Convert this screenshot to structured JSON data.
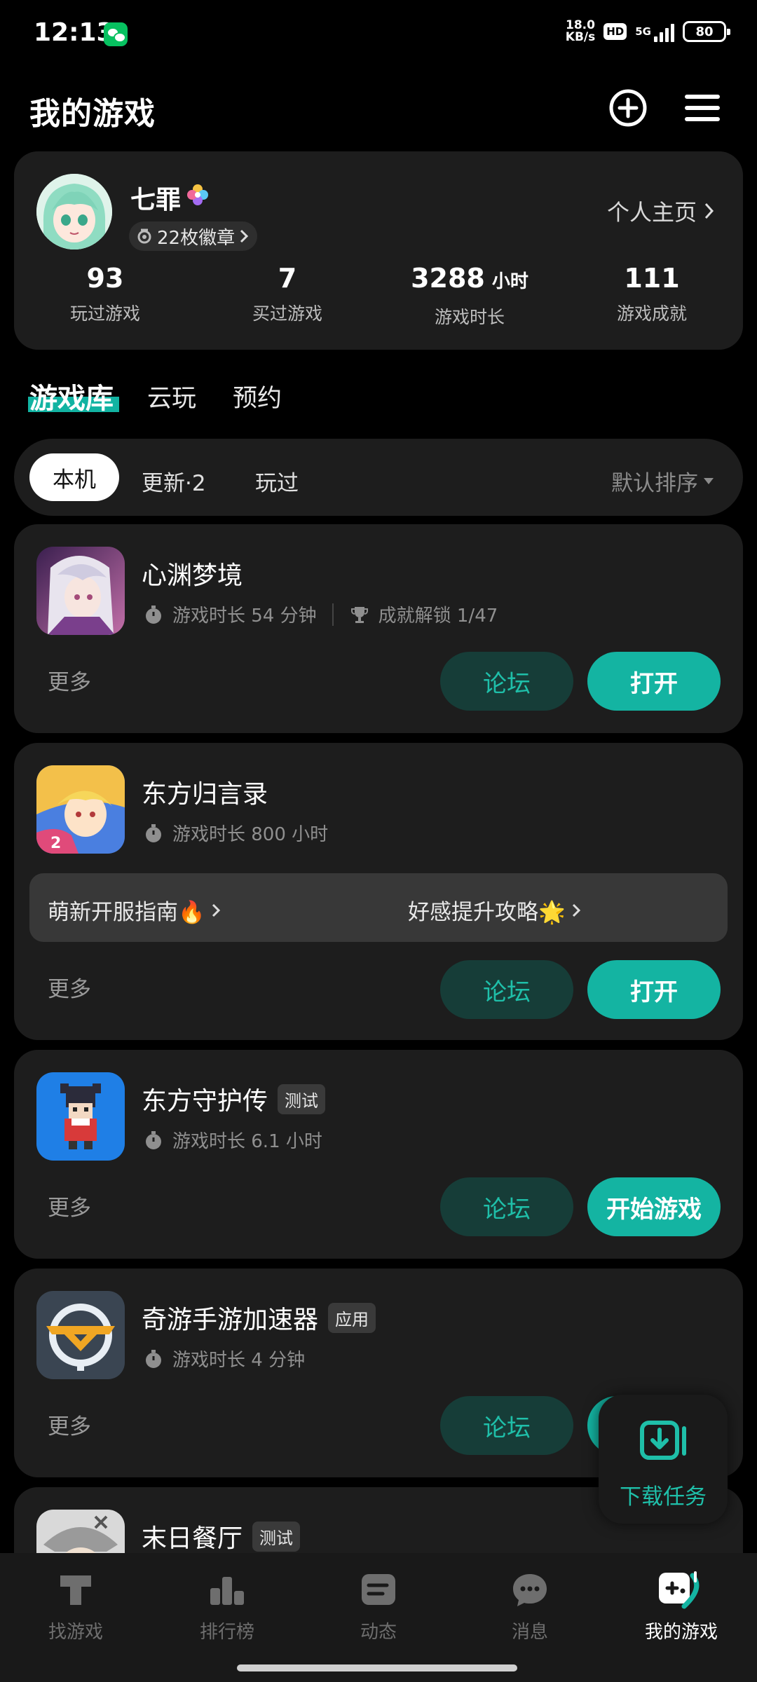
{
  "status": {
    "time": "12:13",
    "speed_top": "18.0",
    "speed_bottom": "KB/s",
    "hd": "HD",
    "network": "5G",
    "battery": "80"
  },
  "header": {
    "title": "我的游戏",
    "add_icon": "plus-circle-icon",
    "menu_icon": "menu-icon"
  },
  "profile": {
    "name": "七罪",
    "badges": "22枚徽章",
    "profile_link": "个人主页",
    "stats": [
      {
        "num": "93",
        "unit": "",
        "label": "玩过游戏"
      },
      {
        "num": "7",
        "unit": "",
        "label": "买过游戏"
      },
      {
        "num": "3288",
        "unit": "小时",
        "label": "游戏时长"
      },
      {
        "num": "111",
        "unit": "",
        "label": "游戏成就"
      }
    ]
  },
  "tabs": {
    "library": "游戏库",
    "cloud": "云玩",
    "reserve": "预约"
  },
  "filters": {
    "local": "本机",
    "update": "更新·2",
    "played": "玩过",
    "sort": "默认排序"
  },
  "games": [
    {
      "name": "心渊梦境",
      "tag": "",
      "playtime": "游戏时长 54 分钟",
      "achievement": "成就解锁 1/47",
      "more": "更多",
      "forum": "论坛",
      "action": "打开"
    },
    {
      "name": "东方归言录",
      "tag": "",
      "playtime": "游戏时长 800 小时",
      "guide_left": "萌新开服指南🔥",
      "guide_right": "好感提升攻略🌟",
      "more": "更多",
      "forum": "论坛",
      "action": "打开"
    },
    {
      "name": "东方守护传",
      "tag": "测试",
      "playtime": "游戏时长 6.1 小时",
      "more": "更多",
      "forum": "论坛",
      "action": "开始游戏"
    },
    {
      "name": "奇游手游加速器",
      "tag": "应用",
      "playtime": "游戏时长 4 分钟",
      "more": "更多",
      "forum": "论坛",
      "action": ""
    },
    {
      "name": "末日餐厅",
      "tag": "测试"
    }
  ],
  "float": {
    "label": "下载任务"
  },
  "nav": [
    {
      "label": "找游戏",
      "icon": "taptap-icon"
    },
    {
      "label": "排行榜",
      "icon": "ranking-icon"
    },
    {
      "label": "动态",
      "icon": "feed-icon"
    },
    {
      "label": "消息",
      "icon": "message-icon"
    },
    {
      "label": "我的游戏",
      "icon": "gamepad-icon"
    }
  ],
  "colors": {
    "accent": "#14b4a2",
    "card": "#1d1d1d",
    "forum_bg": "#163d38"
  }
}
